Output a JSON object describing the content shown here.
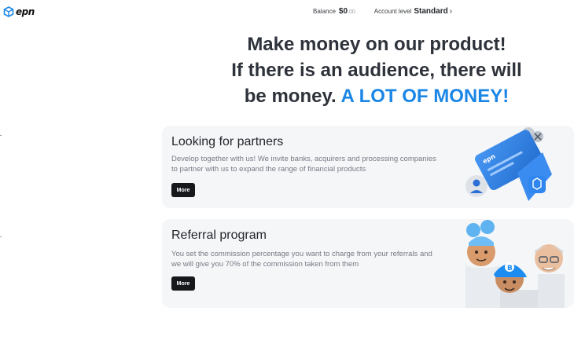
{
  "brand": {
    "logo_icon": "cube-logo-icon",
    "name": "epn"
  },
  "topbar": {
    "balance_label": "Balance",
    "balance_value": "$0",
    "balance_decimal": ".00",
    "account_label": "Account level",
    "account_level": "Standard",
    "account_chevron": "›"
  },
  "hero": {
    "line1": "Make money on our product!",
    "line2": "If there is an audience, there will",
    "line3_plain": "be money. ",
    "line3_accent": "A LOT OF MONEY!"
  },
  "cards": [
    {
      "title": "Looking for partners",
      "description": "Develop together with us! We invite banks, acquirers and processing companies to partner with us to expand the range of financial products",
      "button": "More",
      "art_icon": "bank-card-icon"
    },
    {
      "title": "Referral program",
      "description": "You set the commission percentage you want to charge from your referrals and we will give you 70% of the commission taken from them",
      "button": "More",
      "art_icon": "avatars-illustration-icon"
    }
  ],
  "colors": {
    "accent": "#1b86e6",
    "button_bg": "#16181c",
    "card_bg": "#f5f6f8"
  }
}
